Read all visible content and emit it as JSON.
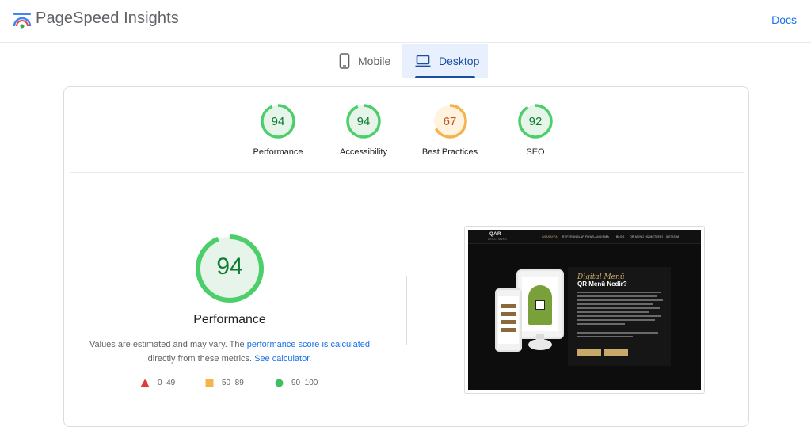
{
  "header": {
    "title": "PageSpeed Insights",
    "docs_label": "Docs"
  },
  "tabs": {
    "mobile": "Mobile",
    "desktop": "Desktop",
    "active": "desktop"
  },
  "categories": [
    {
      "label": "Performance",
      "score": 94,
      "status": "pass"
    },
    {
      "label": "Accessibility",
      "score": 94,
      "status": "pass"
    },
    {
      "label": "Best Practices",
      "score": 67,
      "status": "average"
    },
    {
      "label": "SEO",
      "score": 92,
      "status": "pass"
    }
  ],
  "performance": {
    "score": 94,
    "label": "Performance",
    "note_prefix": "Values are estimated and may vary. The",
    "note_link": "performance score is calculated",
    "note_mid": "directly from these metrics.",
    "note_link2": "See calculator."
  },
  "legend": [
    {
      "range": "0–49",
      "shape": "triangle",
      "color": "#e53935"
    },
    {
      "range": "50–89",
      "shape": "square",
      "color": "#f4b34d"
    },
    {
      "range": "90–100",
      "shape": "circle",
      "color": "#3fbf5f"
    }
  ],
  "colors": {
    "pass": "#0c7c2f",
    "pass_ring": "#4cce6a",
    "average": "#c0531a",
    "average_ring": "#f4b34d",
    "link": "#1a73e8"
  },
  "screenshot": {
    "brand": "QAR",
    "brand_sub": "AKILLI MENÜ",
    "nav": [
      "ANASAYFA",
      "REFERANSLAR",
      "FİYATLANDIRMA",
      "BLOG",
      "QR MENÜ HİZMETLERİ",
      "İLETİŞİM"
    ],
    "script_title": "Digital Menü",
    "heading": "QR Menü Nedir?"
  }
}
